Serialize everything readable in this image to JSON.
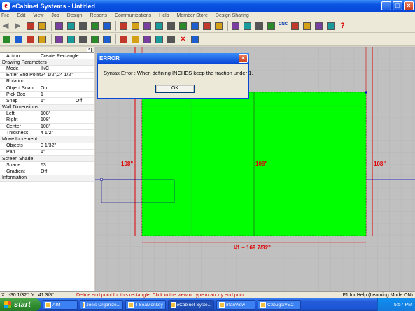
{
  "window": {
    "title": "eCabinet Systems - Untitled",
    "minimize": "_",
    "maximize": "□",
    "close": "×",
    "icon_letter": "e"
  },
  "menu": [
    "File",
    "Edit",
    "View",
    "Job",
    "Design",
    "Reports",
    "Communications",
    "Help",
    "Member Store",
    "Design Sharing"
  ],
  "toolbar1": [
    "back-arrow-icon",
    "forward-arrow-icon",
    "stop-icon",
    "refresh-icon",
    "new-doc-icon",
    "save-icon",
    "print-icon",
    "undo-icon",
    "pointer-icon",
    "cabinet-icon",
    "pencil-icon",
    "ruler-icon",
    "shape-icon",
    "layer-icon",
    "cabinet-front-icon",
    "cabinet-side-icon",
    "drawer-icon",
    "door-icon",
    "page-icon",
    "page-copy-icon",
    "page-move-icon",
    "page-delete-icon",
    "cnc-icon",
    "sheet-icon",
    "cart-icon",
    "truck-icon",
    "monitor-icon",
    "help-icon"
  ],
  "toolbar1_cnc": "CNC",
  "toolbar2": [
    "toolbox-icon",
    "grid-view-icon",
    "tiles-icon",
    "layout-icon",
    "drawer-view-icon",
    "part-view-icon",
    "panel-icon",
    "door-view-icon",
    "cabinet-3d-icon",
    "edit-tool-icon",
    "edit-cabinet-icon",
    "edit-job-icon",
    "options-icon",
    "dotted-grid-icon",
    "delete-x-icon",
    "camera-icon"
  ],
  "panel": {
    "action_label": "Action",
    "action_value": "Create Rectangle",
    "sections": [
      {
        "title": "Drawing Parameters",
        "rows": [
          {
            "k": "Mode",
            "v": "INC",
            "v2": ""
          },
          {
            "k": "Enter End Point",
            "v": "24 1/2\",24 1/2\"",
            "v2": ""
          },
          {
            "k": "Rotation",
            "v": "",
            "v2": ""
          },
          {
            "k": "Object Snap",
            "v": "On",
            "v2": ""
          },
          {
            "k": "Pick Box",
            "v": "1",
            "v2": ""
          },
          {
            "k": "Snap",
            "v": "1\"",
            "v2": "Off"
          }
        ]
      },
      {
        "title": "Wall Dimensions",
        "rows": [
          {
            "k": "Left",
            "v": "108\"",
            "v2": ""
          },
          {
            "k": "Right",
            "v": "108\"",
            "v2": ""
          },
          {
            "k": "Center",
            "v": "108\"",
            "v2": ""
          },
          {
            "k": "Thickness",
            "v": "4 1/2\"",
            "v2": ""
          }
        ]
      },
      {
        "title": "Move Increment",
        "rows": [
          {
            "k": "Objects",
            "v": "0 1/32\"",
            "v2": ""
          },
          {
            "k": "Pan",
            "v": "1\"",
            "v2": ""
          }
        ]
      },
      {
        "title": "Screen Shade",
        "rows": [
          {
            "k": "Shade",
            "v": "63",
            "v2": ""
          },
          {
            "k": "Gradient",
            "v": "Off",
            "v2": ""
          }
        ]
      },
      {
        "title": "Information",
        "rows": []
      }
    ]
  },
  "canvas": {
    "dim_left": "108\"",
    "dim_center": "108\"",
    "dim_right": "108\"",
    "dim_bottom": "#1 ~ 169 7/32\"",
    "colors": {
      "background": "#c0c0c0",
      "rect_fill": "#00ff00",
      "wall_line": "#e00000",
      "axis_line": "#0000c8"
    }
  },
  "dialog": {
    "title": "ERROR",
    "message": "Syntax Error : When defining INCHES keep the fraction under 1.",
    "ok_label": "OK",
    "close": "×"
  },
  "status": {
    "coords": "X : -30 1/32\", Y : 41 3/8\"",
    "message": "Define end point for this rectangle. Click in the view or type in an x,y end point",
    "help": "F1 for Help (Learning Mode ON)"
  },
  "taskbar": {
    "start": "start",
    "items": [
      "AIM",
      "Joe's Organize...",
      "4 SeaMonkey",
      "eCabinet Syste...",
      "IrfanView",
      "C:\\bugs\\V5.2"
    ],
    "active_index": 3,
    "clock": "5:57 PM"
  }
}
